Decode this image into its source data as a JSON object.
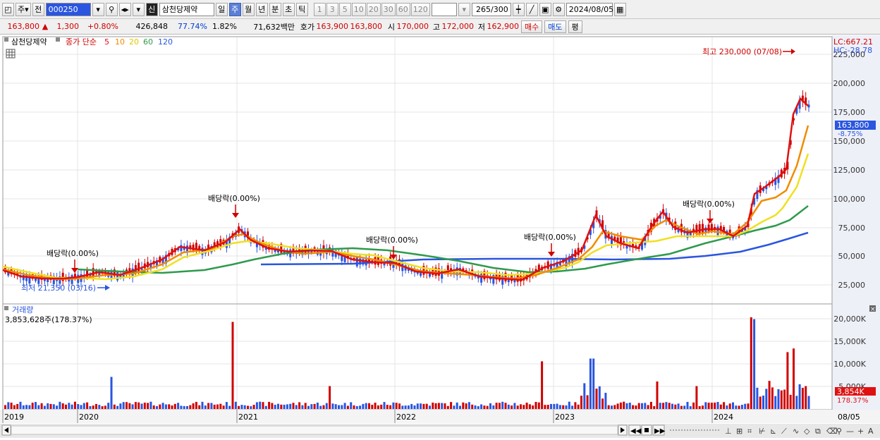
{
  "toolbar": {
    "market": "주",
    "prev": "전",
    "code": "000250",
    "name_badge": "신",
    "name": "삼천당제약",
    "periods": [
      "일",
      "주",
      "월",
      "년",
      "분",
      "초",
      "틱"
    ],
    "active_period": "주",
    "minutes": [
      "1",
      "3",
      "5",
      "10",
      "20",
      "30",
      "60",
      "120"
    ],
    "count": "265",
    "count_max": "/300",
    "date": "2024/08/05"
  },
  "quote": {
    "price": "163,800",
    "change_arrow": "▲",
    "change": "1,300",
    "change_pct": "+0.80%",
    "volume": "426,848",
    "vol_ratio": "77.74%",
    "turnover": "1.82%",
    "amount": "71,632백만",
    "ask_label": "호가",
    "ask": "163,900",
    "bid": "163,800",
    "open_label": "시",
    "open": "170,000",
    "high_label": "고",
    "high": "172,000",
    "low_label": "저",
    "low": "162,900",
    "buy": "매수",
    "sell": "매도",
    "avg": "평"
  },
  "price_legend": {
    "name": "삼천당제약",
    "series_label": "종가 단순",
    "ma": [
      {
        "label": "5",
        "color": "#e01010"
      },
      {
        "label": "10",
        "color": "#f08c00"
      },
      {
        "label": "20",
        "color": "#f0e020"
      },
      {
        "label": "60",
        "color": "#2e9a4c"
      },
      {
        "label": "120",
        "color": "#2a55e0"
      }
    ]
  },
  "lc_hc": {
    "lc": "LC:667.21",
    "hc": "HC:-28.78"
  },
  "price_axis": [
    "225,000",
    "200,000",
    "175,000",
    "150,000",
    "125,000",
    "100,000",
    "75,000",
    "50,000",
    "25,000"
  ],
  "current_tag": {
    "price": "163,800",
    "pct": "-8.75%"
  },
  "annotations": {
    "high": "최고 230,000 (07/08)",
    "low": "최저 21,350 (03/16)",
    "dividends": [
      "배당락(0.00%)",
      "배당락(0.00%)",
      "배당락(0.00%)",
      "배당락(0.00%)",
      "배당락(0.00%)"
    ]
  },
  "volume_panel": {
    "title": "거래량",
    "value": "3,853,628주(178.37%)",
    "axis": [
      "20,000K",
      "15,000K",
      "10,000K",
      "5,000K"
    ],
    "tag_value": "3,854K",
    "tag_pct": "178.37%"
  },
  "x_axis": [
    "2019",
    "2020",
    "2021",
    "2022",
    "2023",
    "2024",
    "08/05"
  ],
  "colors": {
    "up": "#d00000",
    "down": "#2a55e0",
    "ma5": "#e01010",
    "ma10": "#f08c00",
    "ma20": "#f0e020",
    "ma60": "#2e9a4c",
    "ma120": "#2a55e0"
  },
  "chart_data": {
    "type": "line",
    "x": [
      "2019-01",
      "2019-07",
      "2020-01",
      "2020-04",
      "2020-07",
      "2020-10",
      "2020-12",
      "2021-03",
      "2021-06",
      "2021-09",
      "2021-12",
      "2022-03",
      "2022-06",
      "2022-09",
      "2022-12",
      "2023-01",
      "2023-03",
      "2023-05",
      "2023-08",
      "2023-10",
      "2023-12",
      "2024-01",
      "2024-03",
      "2024-05",
      "2024-07",
      "2024-08"
    ],
    "series": [
      {
        "name": "5",
        "values": [
          35000,
          30000,
          33000,
          25000,
          38000,
          48000,
          62000,
          70000,
          50000,
          52000,
          50000,
          40000,
          36000,
          42000,
          30000,
          45000,
          60000,
          75000,
          55000,
          85000,
          65000,
          70000,
          70000,
          120000,
          200000,
          183000
        ]
      },
      {
        "name": "120",
        "values": [
          null,
          null,
          null,
          null,
          null,
          null,
          null,
          null,
          45000,
          46000,
          47000,
          48000,
          48000,
          48000,
          48000,
          48000,
          48000,
          48000,
          48000,
          48500,
          50000,
          51000,
          52000,
          58000,
          65000,
          70000
        ]
      }
    ],
    "ylim": [
      0,
      240000
    ],
    "volume_ylim": [
      0,
      22000
    ]
  }
}
